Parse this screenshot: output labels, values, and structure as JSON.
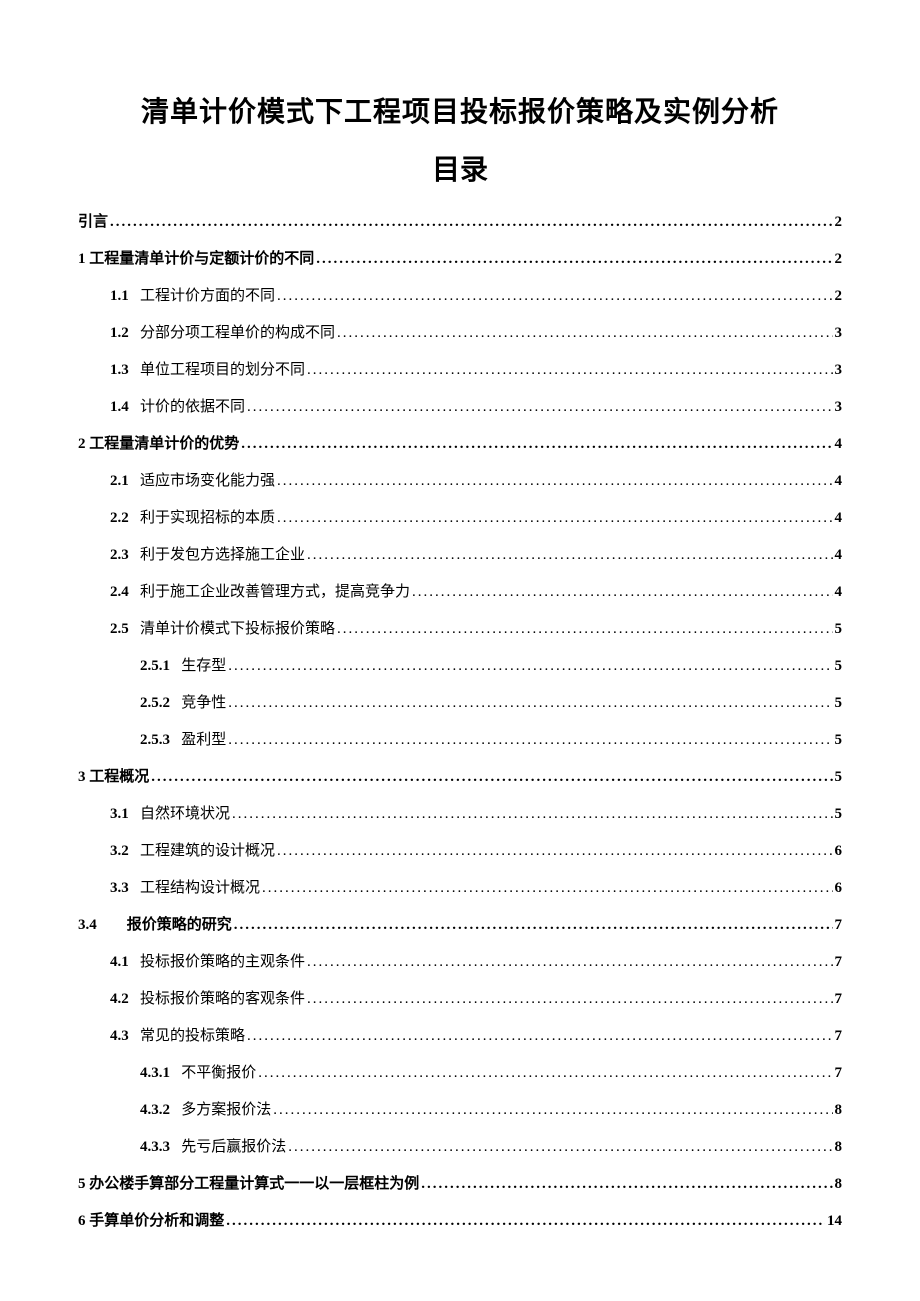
{
  "title": "清单计价模式下工程项目投标报价策略及实例分析",
  "toc_title": "目录",
  "entries": [
    {
      "num": "",
      "label": "引言",
      "page": "2",
      "indent": "ind0",
      "bold": true
    },
    {
      "num": "1 ",
      "label": "工程量清单计价与定额计价的不同",
      "page": "2",
      "indent": "ind0",
      "bold": true
    },
    {
      "num": "1.1   ",
      "label": "工程计价方面的不同",
      "page": "2",
      "indent": "ind1",
      "bold": false
    },
    {
      "num": "1.2   ",
      "label": "分部分项工程单价的构成不同",
      "page": "3",
      "indent": "ind1",
      "bold": false
    },
    {
      "num": "1.3   ",
      "label": "单位工程项目的划分不同",
      "page": "3",
      "indent": "ind1",
      "bold": false
    },
    {
      "num": "1.4   ",
      "label": "计价的依据不同",
      "page": "3",
      "indent": "ind1",
      "bold": false
    },
    {
      "num": "2 ",
      "label": "工程量清单计价的优势",
      "page": "4",
      "indent": "ind0",
      "bold": true
    },
    {
      "num": "2.1   ",
      "label": "适应市场变化能力强",
      "page": "4",
      "indent": "ind1",
      "bold": false
    },
    {
      "num": "2.2   ",
      "label": "利于实现招标的本质",
      "page": "4",
      "indent": "ind1",
      "bold": false
    },
    {
      "num": "2.3   ",
      "label": "利于发包方选择施工企业",
      "page": "4",
      "indent": "ind1",
      "bold": false
    },
    {
      "num": "2.4   ",
      "label": "利于施工企业改善管理方式，提高竞争力",
      "page": "4",
      "indent": "ind1",
      "bold": false
    },
    {
      "num": "2.5   ",
      "label": "清单计价模式下投标报价策略",
      "page": "5",
      "indent": "ind1",
      "bold": false
    },
    {
      "num": "2.5.1   ",
      "label": "生存型",
      "page": "5",
      "indent": "ind2",
      "bold": false
    },
    {
      "num": "2.5.2   ",
      "label": "竞争性",
      "page": "5",
      "indent": "ind2",
      "bold": false
    },
    {
      "num": "2.5.3   ",
      "label": "盈利型",
      "page": "5",
      "indent": "ind2",
      "bold": false
    },
    {
      "num": "3 ",
      "label": "工程概况",
      "page": "5",
      "indent": "ind0",
      "bold": true
    },
    {
      "num": "3.1   ",
      "label": "自然环境状况",
      "page": "5",
      "indent": "ind1",
      "bold": false
    },
    {
      "num": "3.2   ",
      "label": "工程建筑的设计概况",
      "page": "6",
      "indent": "ind1",
      "bold": false
    },
    {
      "num": "3.3   ",
      "label": "工程结构设计概况",
      "page": "6",
      "indent": "ind1",
      "bold": false
    },
    {
      "num": "3.4        ",
      "label": "报价策略的研究",
      "page": "7",
      "indent": "ind1a",
      "bold": true
    },
    {
      "num": "4.1   ",
      "label": "投标报价策略的主观条件",
      "page": "7",
      "indent": "ind1",
      "bold": false
    },
    {
      "num": "4.2   ",
      "label": "投标报价策略的客观条件",
      "page": "7",
      "indent": "ind1",
      "bold": false
    },
    {
      "num": "4.3   ",
      "label": "常见的投标策略",
      "page": "7",
      "indent": "ind1",
      "bold": false
    },
    {
      "num": "4.3.1   ",
      "label": "不平衡报价",
      "page": "7",
      "indent": "ind2",
      "bold": false
    },
    {
      "num": "4.3.2   ",
      "label": "多方案报价法",
      "page": "8",
      "indent": "ind2",
      "bold": false
    },
    {
      "num": "4.3.3   ",
      "label": "先亏后赢报价法",
      "page": "8",
      "indent": "ind2",
      "bold": false
    },
    {
      "num": "5 ",
      "label": "办公楼手算部分工程量计算式一一以一层框柱为例",
      "page": "8",
      "indent": "ind0",
      "bold": true
    },
    {
      "num": "6 ",
      "label": "手算单价分析和调整",
      "page": "14",
      "indent": "ind0",
      "bold": true
    }
  ]
}
